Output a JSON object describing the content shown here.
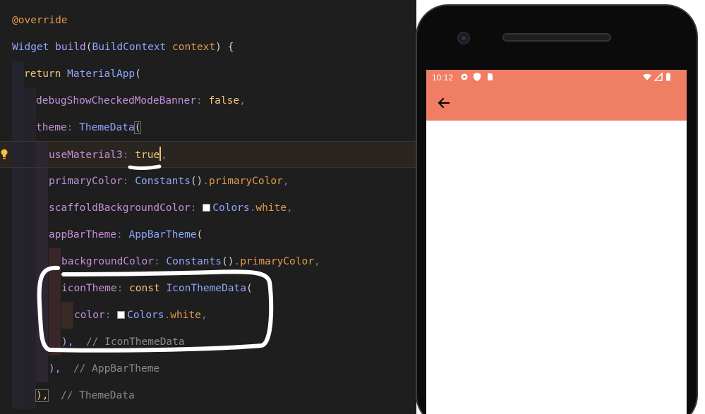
{
  "editor": {
    "lines": [
      {
        "id": "l1",
        "parts": [
          "@override"
        ]
      },
      {
        "id": "l2",
        "parts": [
          "Widget",
          " ",
          "build",
          "(",
          "BuildContext",
          " ",
          "context",
          ")",
          " {"
        ]
      },
      {
        "id": "l3",
        "parts": [
          "return",
          " ",
          "MaterialApp",
          "("
        ]
      },
      {
        "id": "l4",
        "parts": [
          "debugShowCheckedModeBanner",
          ":",
          " ",
          "false",
          ","
        ]
      },
      {
        "id": "l5",
        "parts": [
          "theme",
          ":",
          " ",
          "ThemeData",
          "("
        ]
      },
      {
        "id": "l6",
        "parts": [
          "useMaterial3",
          ":",
          " ",
          "true",
          ","
        ]
      },
      {
        "id": "l7",
        "parts": [
          "primaryColor",
          ":",
          " ",
          "Constants",
          "()",
          ".",
          "primaryColor",
          ","
        ]
      },
      {
        "id": "l8",
        "parts": [
          "scaffoldBackgroundColor",
          ":",
          " ",
          "Colors",
          ".",
          "white",
          ","
        ]
      },
      {
        "id": "l9",
        "parts": [
          "appBarTheme",
          ":",
          " ",
          "AppBarTheme",
          "("
        ]
      },
      {
        "id": "l10",
        "parts": [
          "backgroundColor",
          ":",
          " ",
          "Constants",
          "()",
          ".",
          "primaryColor",
          ","
        ]
      },
      {
        "id": "l11",
        "parts": [
          "iconTheme",
          ":",
          " ",
          "const",
          " ",
          "IconThemeData",
          "("
        ]
      },
      {
        "id": "l12",
        "parts": [
          "color",
          ":",
          " ",
          "Colors",
          ".",
          "white",
          ","
        ]
      },
      {
        "id": "l13",
        "parts": [
          "),",
          "  ",
          "// IconThemeData"
        ]
      },
      {
        "id": "l14",
        "parts": [
          "),",
          "  ",
          "// AppBarTheme"
        ]
      },
      {
        "id": "l15",
        "parts": [
          "),",
          "  ",
          "// ThemeData"
        ]
      }
    ],
    "icons": {
      "hint": "lightbulb-icon"
    },
    "colors": {
      "background": "#1e1e1e",
      "annotation": "#ffffff"
    }
  },
  "phone": {
    "status_bar": {
      "time": "10:12",
      "left_icons": [
        "gear-icon",
        "shield-icon",
        "sim-card-icon"
      ],
      "right_icons": [
        "wifi-icon",
        "signal-icon",
        "battery-icon"
      ]
    },
    "app_bar": {
      "leading_icon": "arrow-back-icon",
      "background_color": "#ef7e64"
    },
    "body_color": "#ffffff"
  }
}
